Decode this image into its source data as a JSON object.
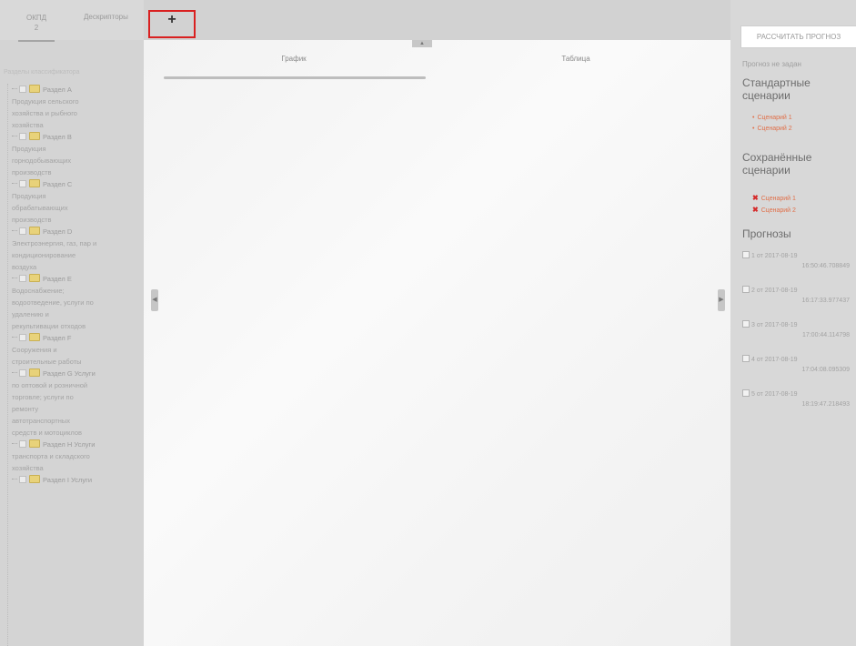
{
  "left_panel": {
    "tabs": [
      {
        "label_line1": "ОКПД",
        "label_line2": "2"
      },
      {
        "label": "Дескрипторы"
      }
    ],
    "tree_caption": "Разделы классификатора",
    "tree": [
      {
        "head": "Раздел A",
        "desc": [
          "Продукция сельского",
          "хозяйства и рыбного",
          "хозяйства"
        ]
      },
      {
        "head": "Раздел B",
        "desc": [
          "Продукция",
          "горнодобывающих",
          "производств"
        ]
      },
      {
        "head": "Раздел C",
        "desc": [
          "Продукция",
          "обрабатывающих",
          "производств"
        ]
      },
      {
        "head": "Раздел D",
        "desc": [
          "Электроэнергия, газ, пар и",
          "кондиционирование",
          "воздуха"
        ]
      },
      {
        "head": "Раздел E",
        "desc": [
          "Водоснабжение;",
          "водоотведение, услуги по",
          "удалению и",
          "рекультивации отходов"
        ]
      },
      {
        "head": "Раздел F",
        "desc": [
          "Сооружения и",
          "строительные работы"
        ]
      },
      {
        "head": "Раздел G Услуги",
        "desc": [
          "по оптовой и розничной",
          "торговле; услуги по",
          "ремонту",
          "автотранспортных",
          "средств и мотоциклов"
        ]
      },
      {
        "head": "Раздел H Услуги",
        "desc": [
          "транспорта и складского",
          "хозяйства"
        ]
      },
      {
        "head": "Раздел I Услуги",
        "desc": []
      }
    ]
  },
  "toolbar": {
    "add_icon": "plus-icon",
    "add_glyph": "+"
  },
  "main": {
    "tabs": [
      {
        "label": "График"
      },
      {
        "label": "Таблица"
      }
    ],
    "collapse_glyph": "▲",
    "left_handle_glyph": "◀",
    "right_handle_glyph": "▶"
  },
  "right_panel": {
    "calc_button": "РАССЧИТАТЬ ПРОГНОЗ",
    "forecast_status": "Прогноз не задан",
    "standard_title": "Стандартные сценарии",
    "standard": [
      "Сценарий 1",
      "Сценарий 2"
    ],
    "saved_title": "Сохранённые сценарии",
    "saved": [
      "Сценарий 1",
      "Сценарий 2"
    ],
    "forecasts_title": "Прогнозы",
    "forecasts": [
      {
        "date": "1 от 2017-08-19",
        "time": "16:50:46.708849"
      },
      {
        "date": "2 от 2017-08-19",
        "time": "16:17:33.977437"
      },
      {
        "date": "3 от 2017-08-19",
        "time": "17:00:44.114798"
      },
      {
        "date": "4 от 2017-08-19",
        "time": "17:04:08.095309"
      },
      {
        "date": "5 от 2017-08-19",
        "time": "18:19:47.218493"
      }
    ]
  },
  "colors": {
    "highlight": "#d92020",
    "scenario_link": "#e0704a",
    "delete": "#d52a2a"
  }
}
